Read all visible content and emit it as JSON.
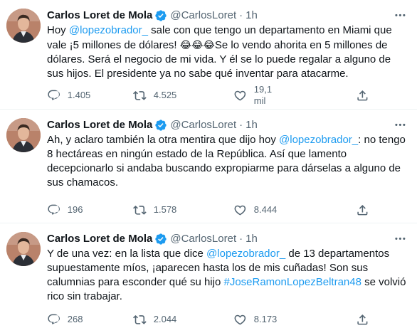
{
  "author": {
    "name": "Carlos Loret de Mola",
    "handle": "@CarlosLoret",
    "separator": "·"
  },
  "colors": {
    "accent": "#1d9bf0",
    "text": "#0f1419",
    "muted": "#536471"
  },
  "icons": [
    "verified-badge-icon",
    "more-icon",
    "reply-icon",
    "retweet-icon",
    "like-icon",
    "share-icon"
  ],
  "tweets": [
    {
      "time": "1h",
      "segments": [
        {
          "t": "Hoy ",
          "type": "text"
        },
        {
          "t": "@lopezobrador_",
          "type": "mention"
        },
        {
          "t": " sale con que tengo un departamento en Miami que vale ¡5 millones de dólares! ",
          "type": "text"
        },
        {
          "t": "😂😂😂",
          "type": "emoji"
        },
        {
          "t": "Se lo vendo ahorita en 5 millones de dólares. Será el negocio de mi vida. Y él se lo puede regalar a alguno de sus hijos. El presidente ya no sabe qué inventar para atacarme.",
          "type": "text"
        }
      ],
      "replies": "1.405",
      "retweets": "4.525",
      "likes": "19,1 mil"
    },
    {
      "time": "1h",
      "segments": [
        {
          "t": "Ah, y aclaro también la otra mentira que dijo hoy ",
          "type": "text"
        },
        {
          "t": "@lopezobrador_",
          "type": "mention"
        },
        {
          "t": ": no tengo 8 hectáreas en ningún estado de la República. Así que lamento decepcionarlo si andaba buscando expropiarme para dárselas a alguno de sus chamacos.",
          "type": "text"
        }
      ],
      "replies": "196",
      "retweets": "1.578",
      "likes": "8.444"
    },
    {
      "time": "1h",
      "segments": [
        {
          "t": "Y de una vez: en la lista que dice ",
          "type": "text"
        },
        {
          "t": "@lopezobrador_",
          "type": "mention"
        },
        {
          "t": " de 13 departamentos supuestamente míos, ¡aparecen hasta los de mis cuñadas! Son sus calumnias para esconder qué su hijo ",
          "type": "text"
        },
        {
          "t": "#JoseRamonLopezBeltran48",
          "type": "mention"
        },
        {
          "t": " se volvió rico sin trabajar.",
          "type": "text"
        }
      ],
      "replies": "268",
      "retweets": "2.044",
      "likes": "8.173"
    }
  ]
}
